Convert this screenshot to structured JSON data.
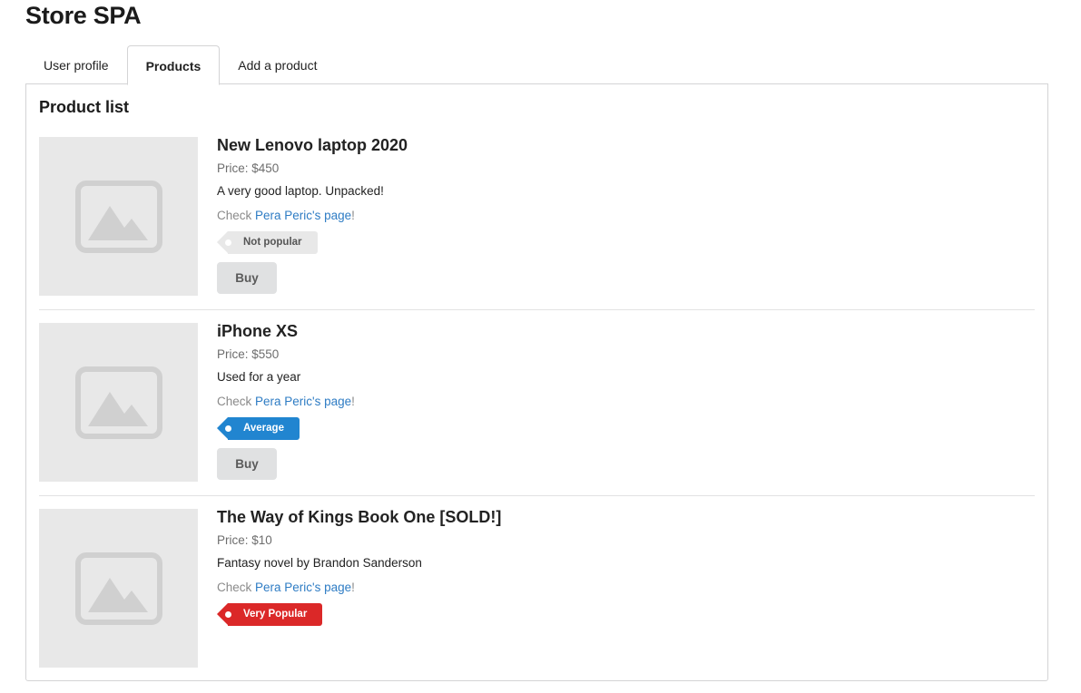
{
  "app": {
    "title": "Store SPA"
  },
  "tabs": [
    {
      "label": "User profile",
      "active": false
    },
    {
      "label": "Products",
      "active": true
    },
    {
      "label": "Add a product",
      "active": false
    }
  ],
  "panel": {
    "title": "Product list"
  },
  "products": [
    {
      "name": "New Lenovo laptop 2020",
      "price": "Price: $450",
      "description": "A very good laptop. Unpacked!",
      "check_prefix": "Check ",
      "owner_link": "Pera Peric's page",
      "check_suffix": "!",
      "popularity": "Not popular",
      "popularity_color": "#e8e8e8",
      "buy_label": "Buy"
    },
    {
      "name": "iPhone XS",
      "price": "Price: $550",
      "description": "Used for a year",
      "check_prefix": "Check ",
      "owner_link": "Pera Peric's page",
      "check_suffix": "!",
      "popularity": "Average",
      "popularity_color": "#2185d0",
      "buy_label": "Buy"
    },
    {
      "name": "The Way of Kings Book One [SOLD!]",
      "price": "Price: $10",
      "description": "Fantasy novel by Brandon Sanderson",
      "check_prefix": "Check ",
      "owner_link": "Pera Peric's page",
      "check_suffix": "!",
      "popularity": "Very Popular",
      "popularity_color": "#db2828"
    }
  ]
}
